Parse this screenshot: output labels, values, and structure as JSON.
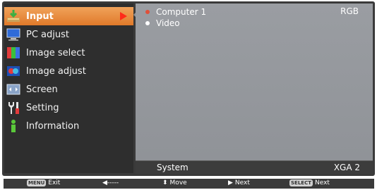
{
  "menu": {
    "items": [
      {
        "label": "Input",
        "icon": "input-icon",
        "active": true
      },
      {
        "label": "PC adjust",
        "icon": "pc-adjust-icon"
      },
      {
        "label": "Image select",
        "icon": "image-select-icon"
      },
      {
        "label": "Image adjust",
        "icon": "image-adjust-icon"
      },
      {
        "label": "Screen",
        "icon": "screen-icon"
      },
      {
        "label": "Setting",
        "icon": "setting-icon"
      },
      {
        "label": "Information",
        "icon": "information-icon"
      }
    ]
  },
  "inputs": [
    {
      "label": "Computer 1",
      "signal": "RGB",
      "selected": true,
      "bullet_color": "#e0503a"
    },
    {
      "label": "Video",
      "signal": "",
      "selected": false,
      "bullet_color": "#ffffff"
    }
  ],
  "system": {
    "label": "System",
    "value": "XGA 2"
  },
  "footer": {
    "exit": {
      "key": "MENU",
      "label": "Exit"
    },
    "back": {
      "symbol": "◀-----"
    },
    "move": {
      "symbol": "⬍",
      "label": "Move"
    },
    "next": {
      "symbol": "▶",
      "label": "Next"
    },
    "select": {
      "key": "SELECT",
      "label": "Next"
    }
  },
  "colors": {
    "active": "#e98a3a",
    "arrow": "#ff2a1a",
    "panel": "#8f9297"
  }
}
